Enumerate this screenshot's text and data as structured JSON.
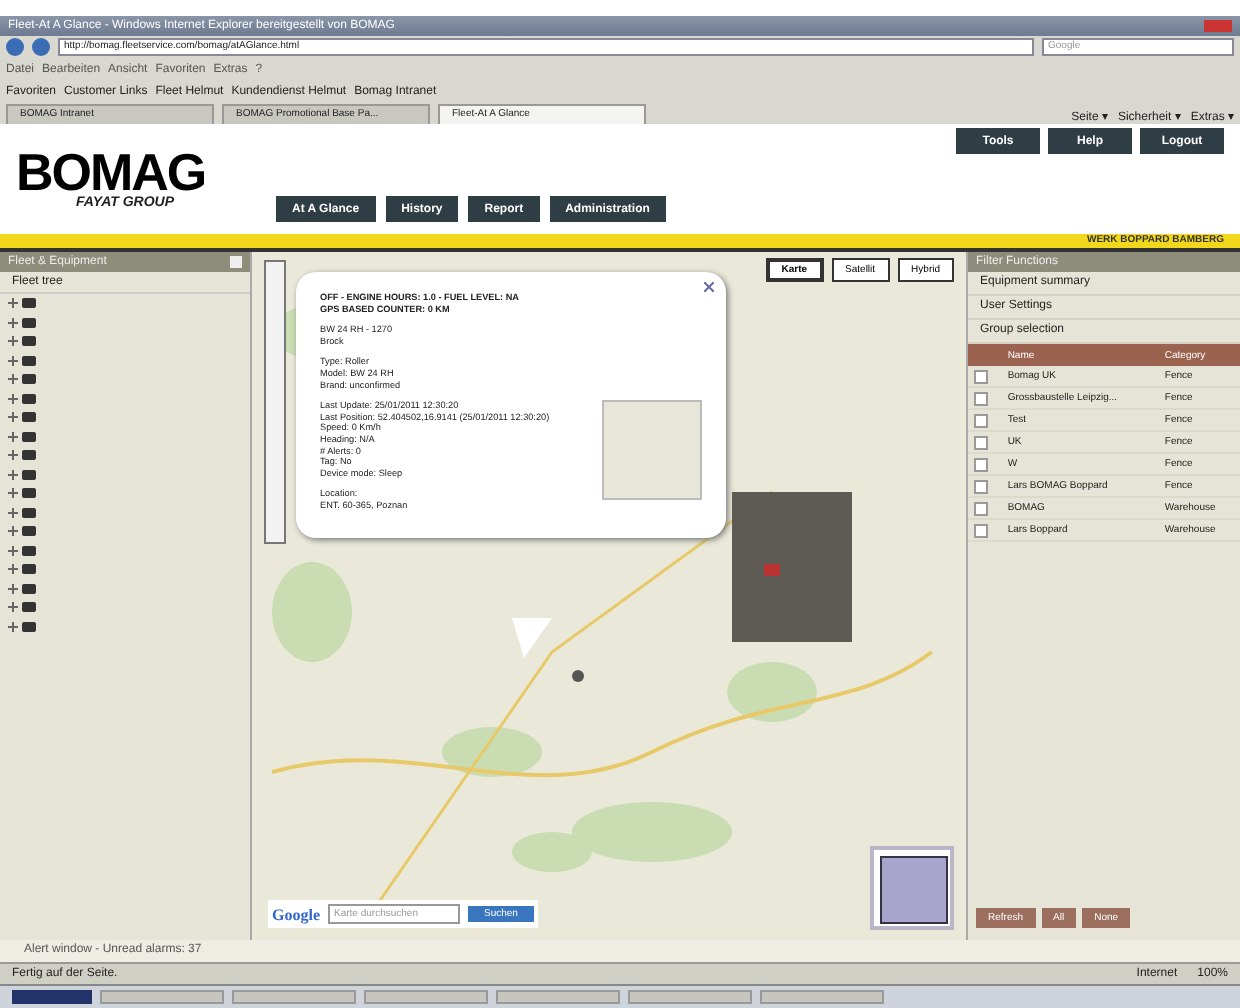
{
  "browser": {
    "title": "Fleet-At A Glance - Windows Internet Explorer bereitgestellt von BOMAG",
    "address": "http://bomag.fleetservice.com/bomag/atAGlance.html",
    "search_placeholder": "Google",
    "menu": [
      "Datei",
      "Bearbeiten",
      "Ansicht",
      "Favoriten",
      "Extras",
      "?"
    ],
    "favorites": [
      "Favoriten",
      "Customer Links",
      "Fleet Helmut",
      "Kundendienst Helmut",
      "Bomag Intranet"
    ],
    "tabs": [
      {
        "label": "BOMAG Intranet",
        "selected": false
      },
      {
        "label": "BOMAG Promotional Base Pa...",
        "selected": false
      },
      {
        "label": "Fleet-At A Glance",
        "selected": true
      }
    ],
    "commands": [
      "Seite ▾",
      "Sicherheit ▾",
      "Extras ▾"
    ]
  },
  "header": {
    "logo": "BOMAG",
    "group": "FAYAT GROUP",
    "nav": [
      "At A Glance",
      "History",
      "Report",
      "Administration"
    ],
    "tools": [
      "Tools",
      "Help",
      "Logout"
    ],
    "banner": "WERK BOPPARD BAMBERG"
  },
  "left_panel": {
    "title": "Fleet & Equipment",
    "tree_root": "Fleet tree",
    "nodes": [
      {
        "expanded": false
      },
      {
        "expanded": false
      },
      {
        "expanded": false
      },
      {
        "expanded": false
      },
      {
        "expanded": false
      },
      {
        "expanded": false
      },
      {
        "expanded": false
      },
      {
        "expanded": false
      },
      {
        "expanded": false
      },
      {
        "expanded": false
      },
      {
        "expanded": false
      },
      {
        "expanded": false
      },
      {
        "expanded": false
      },
      {
        "expanded": false
      },
      {
        "expanded": false
      },
      {
        "expanded": false
      },
      {
        "expanded": false
      },
      {
        "expanded": false
      }
    ]
  },
  "map": {
    "map_types": [
      {
        "label": "Karte",
        "selected": true
      },
      {
        "label": "Satellit",
        "selected": false
      },
      {
        "label": "Hybrid",
        "selected": false
      }
    ],
    "popup": {
      "status": [
        "OFF - ENGINE HOURS: 1.0 - FUEL LEVEL: NA",
        "GPS BASED COUNTER: 0 KM"
      ],
      "groups": [
        [
          "BW 24 RH - 1270",
          "Brock"
        ],
        [
          "Type: Roller",
          "Model: BW 24 RH",
          "Brand: unconfirmed"
        ],
        [
          "Last Update: 25/01/2011 12:30:20",
          "Last Position: 52.404502,16.9141 (25/01/2011 12:30:20)",
          "Speed: 0 Km/h",
          "Heading: N/A",
          "# Alerts: 0",
          "Tag: No",
          "Device mode: Sleep"
        ],
        [
          "Location:",
          "ENT. 60-365, Poznan"
        ]
      ]
    },
    "search_placeholder": "Karte durchsuchen",
    "search_button": "Suchen",
    "google": "Google"
  },
  "right_panel": {
    "title": "Filter Functions",
    "sections": [
      "Equipment summary",
      "User Settings",
      "Group selection"
    ],
    "columns": [
      "Name",
      "Category"
    ],
    "rows": [
      {
        "name": "Bomag UK",
        "category": "Fence",
        "checked": false
      },
      {
        "name": "Grossbaustelle Leipzig...",
        "category": "Fence",
        "checked": false
      },
      {
        "name": "Test",
        "category": "Fence",
        "checked": false
      },
      {
        "name": "UK",
        "category": "Fence",
        "checked": false
      },
      {
        "name": "W",
        "category": "Fence",
        "checked": false
      },
      {
        "name": "Lars BOMAG Boppard",
        "category": "Fence",
        "checked": false
      },
      {
        "name": "BOMAG",
        "category": "Warehouse",
        "checked": false
      },
      {
        "name": "Lars Boppard",
        "category": "Warehouse",
        "checked": false
      }
    ],
    "buttons": [
      "Refresh",
      "All",
      "None"
    ]
  },
  "alert_bar": "Alert window - Unread alarms: 37",
  "status_bar": {
    "text": "Fertig auf der Seite.",
    "zone": "Internet",
    "zoom": "100%"
  }
}
